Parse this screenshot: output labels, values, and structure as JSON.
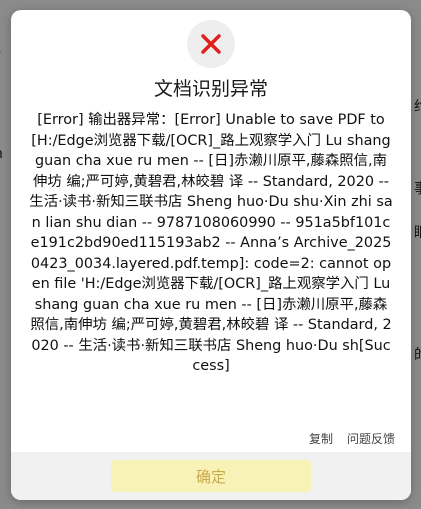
{
  "dialog": {
    "title": "文档识别异常",
    "message": "[Error] 输出器异常：[Error] Unable to save PDF to [H:/Edge浏览器下载/[OCR]_路上观察学入门 Lu shang guan cha xue ru men -- [日]赤濑川原平,藤森照信,南伸坊 编;严可婷,黄碧君,林皎碧 译 -- Standard, 2020 -- 生活·读书·新知三联书店 Sheng huo·Du shu·Xin zhi san lian shu dian -- 9787108060990 -- 951a5bf101ce191c2bd90ed115193ab2 -- Anna’s Archive_20250423_0034.layered.pdf.temp]: code=2: cannot open file 'H:/Edge浏览器下载/[OCR]_路上观察学入门 Lu shang guan cha xue ru men -- [日]赤濑川原平,藤森照信,南伸坊 编;严可婷,黄碧君,林皎碧 译 -- Standard, 2020 -- 生活·读书·新知三联书店 Sheng huo·Du sh[Success]",
    "copy_label": "复制",
    "feedback_label": "问题反馈",
    "ok_label": "确定",
    "icon": "close-icon"
  },
  "colors": {
    "icon_red": "#e0201c",
    "button_bg": "#f9f2b6",
    "button_text": "#c9a94a"
  }
}
